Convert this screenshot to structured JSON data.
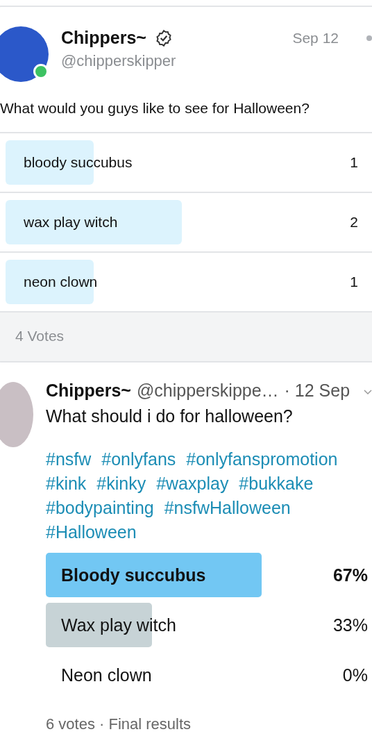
{
  "post": {
    "name": "Chippers~",
    "verified": true,
    "handle": "@chipperskipper",
    "date": "Sep 12",
    "online": true,
    "text": "What would you guys like to see for Halloween?",
    "poll": {
      "options": [
        {
          "label": "bloody succubus",
          "count": "1"
        },
        {
          "label": "wax play witch",
          "count": "2"
        },
        {
          "label": "neon clown",
          "count": "1"
        }
      ],
      "votes": "4 Votes"
    }
  },
  "tweet": {
    "name": "Chippers~",
    "handle": "@chipperskippe…",
    "date": "· 12 Sep",
    "text": "What should i do for halloween?",
    "hashtags": [
      "#nsfw",
      "#onlyfans",
      "#onlyfanspromotion",
      "#kink",
      "#kinky",
      "#waxplay",
      "#bukkake",
      "#bodypainting",
      "#nsfwHalloween",
      "#Halloween"
    ],
    "poll": {
      "options": [
        {
          "label": "Bloody succubus",
          "percent": "67%",
          "selected": true
        },
        {
          "label": "Wax play witch",
          "percent": "33%",
          "selected": false
        },
        {
          "label": "Neon clown",
          "percent": "0%",
          "selected": false
        }
      ],
      "footer": "6 votes · Final results"
    }
  }
}
